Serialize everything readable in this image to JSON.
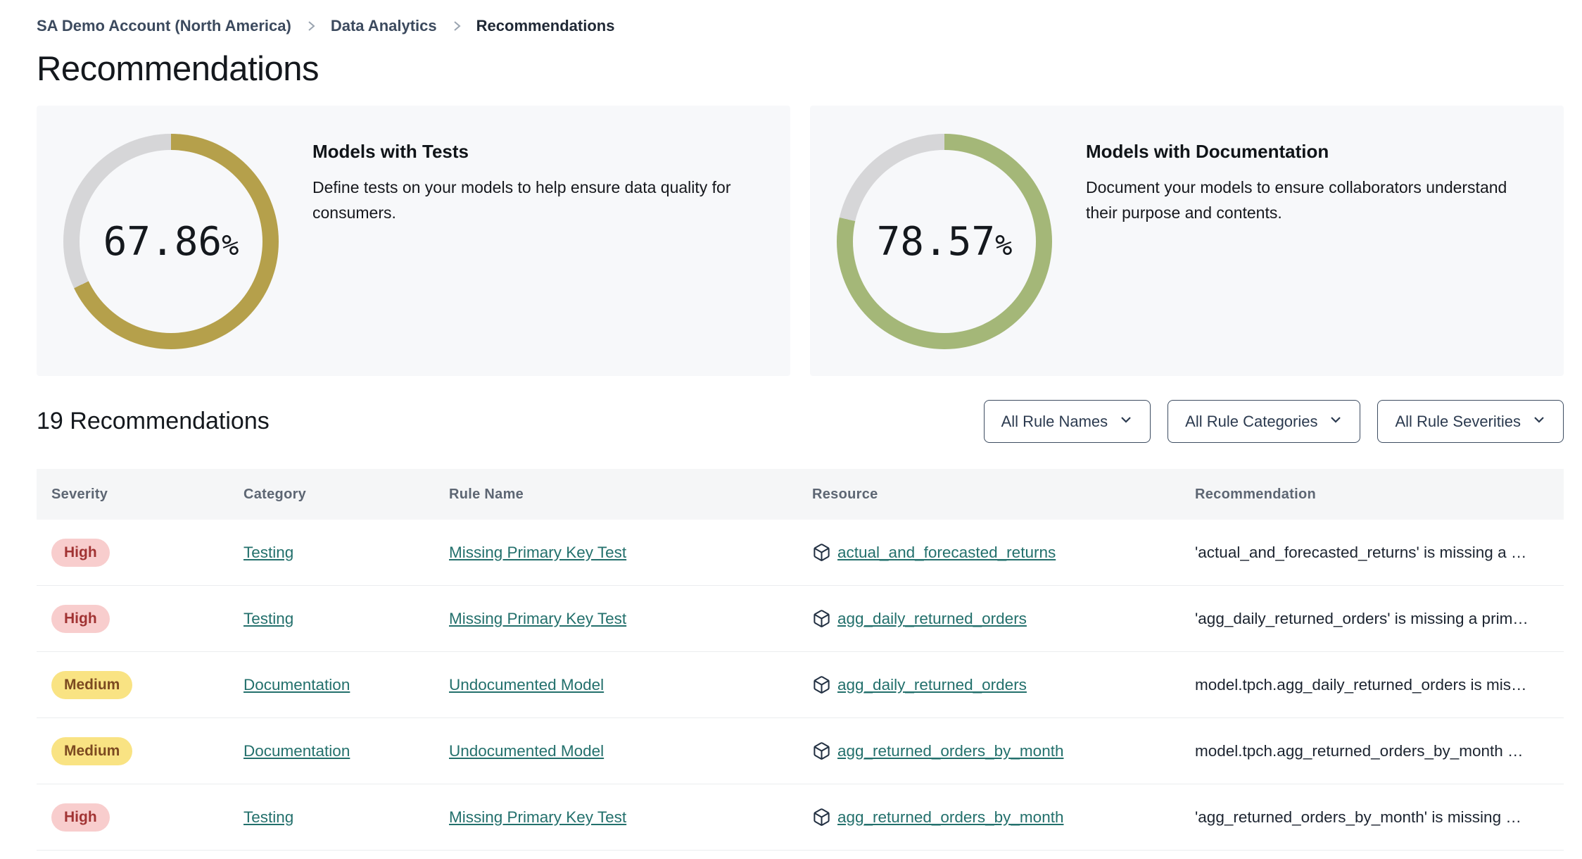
{
  "breadcrumb": {
    "items": [
      {
        "label": "SA Demo Account (North America)"
      },
      {
        "label": "Data Analytics"
      },
      {
        "label": "Recommendations"
      }
    ]
  },
  "page": {
    "title": "Recommendations"
  },
  "cards": [
    {
      "title": "Models with Tests",
      "description": "Define tests on your models to help ensure data quality for consumers.",
      "percent": 67.86,
      "percent_display": "67.86",
      "percent_sign": "%",
      "ring_color": "#b5a04b",
      "track_color": "#d6d6d8"
    },
    {
      "title": "Models with Documentation",
      "description": "Document your models to ensure collaborators understand their purpose and contents.",
      "percent": 78.57,
      "percent_display": "78.57",
      "percent_sign": "%",
      "ring_color": "#a4b778",
      "track_color": "#d6d6d8"
    }
  ],
  "list_header": {
    "title": "19 Recommendations",
    "filters": [
      {
        "label": "All Rule Names"
      },
      {
        "label": "All Rule Categories"
      },
      {
        "label": "All Rule Severities"
      }
    ]
  },
  "table": {
    "columns": [
      "Severity",
      "Category",
      "Rule Name",
      "Resource",
      "Recommendation"
    ],
    "rows": [
      {
        "severity": "High",
        "category": "Testing",
        "rule_name": "Missing Primary Key Test",
        "resource": "actual_and_forecasted_returns",
        "recommendation": "'actual_and_forecasted_returns' is missing a …"
      },
      {
        "severity": "High",
        "category": "Testing",
        "rule_name": "Missing Primary Key Test",
        "resource": "agg_daily_returned_orders",
        "recommendation": "'agg_daily_returned_orders' is missing a prim…"
      },
      {
        "severity": "Medium",
        "category": "Documentation",
        "rule_name": "Undocumented Model",
        "resource": "agg_daily_returned_orders",
        "recommendation": "model.tpch.agg_daily_returned_orders is mis…"
      },
      {
        "severity": "Medium",
        "category": "Documentation",
        "rule_name": "Undocumented Model",
        "resource": "agg_returned_orders_by_month",
        "recommendation": "model.tpch.agg_returned_orders_by_month …"
      },
      {
        "severity": "High",
        "category": "Testing",
        "rule_name": "Missing Primary Key Test",
        "resource": "agg_returned_orders_by_month",
        "recommendation": "'agg_returned_orders_by_month' is missing …"
      }
    ]
  },
  "severity_colors": {
    "High": {
      "bg": "#f8cdcd",
      "text": "#a13333"
    },
    "Medium": {
      "bg": "#f9e383",
      "text": "#7c4a21"
    }
  },
  "colors": {
    "link": "#23706c",
    "accent_gold": "#b5a04b",
    "accent_green": "#a4b778"
  }
}
